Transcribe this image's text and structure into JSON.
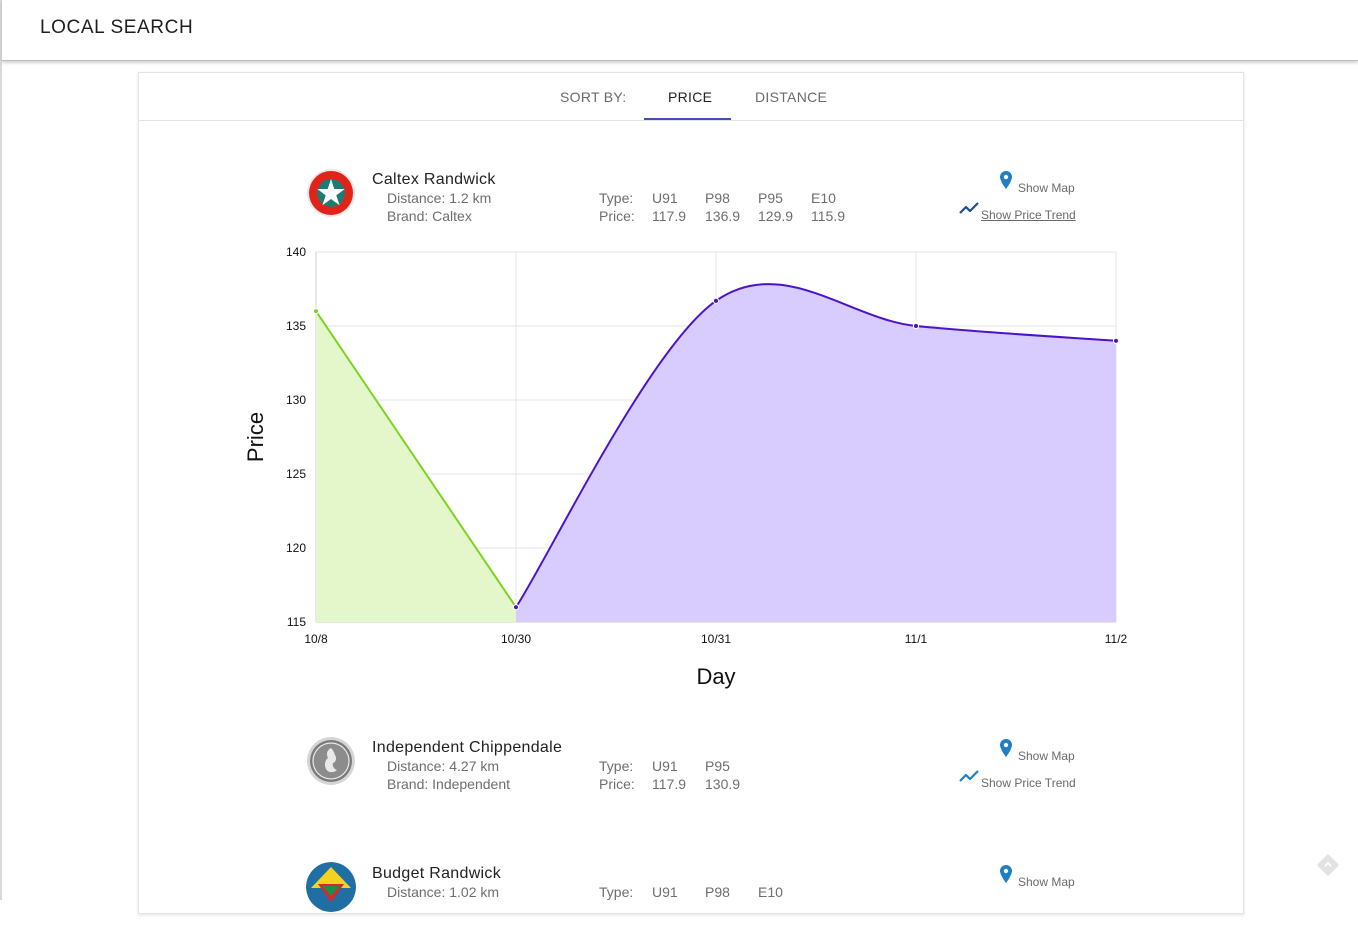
{
  "app": {
    "title": "LOCAL SEARCH"
  },
  "tabs": {
    "sort_label": "SORT BY:",
    "price": "PRICE",
    "distance": "DISTANCE",
    "active": "price"
  },
  "stations": [
    {
      "name": "Caltex Randwick",
      "distance": "Distance: 1.2 km",
      "brand": "Brand: Caltex",
      "type_label": "Type:",
      "price_label": "Price:",
      "fuel_types": [
        "U91",
        "P98",
        "P95",
        "E10"
      ],
      "prices": [
        "117.9",
        "136.9",
        "129.9",
        "115.9"
      ],
      "show_map": "Show Map",
      "show_trend": "Show Price Trend",
      "logo": "caltex-star-logo"
    },
    {
      "name": "Independent Chippendale",
      "distance": "Distance: 4.27 km",
      "brand": "Brand: Independent",
      "type_label": "Type:",
      "price_label": "Price:",
      "fuel_types": [
        "U91",
        "P95"
      ],
      "prices": [
        "117.9",
        "130.9"
      ],
      "show_map": "Show Map",
      "show_trend": "Show Price Trend",
      "logo": "independent-logo"
    },
    {
      "name": "Budget Randwick",
      "distance": "Distance: 1.02 km",
      "brand": "",
      "type_label": "Type:",
      "price_label": "",
      "fuel_types": [
        "U91",
        "P98",
        "E10"
      ],
      "prices": [],
      "show_map": "Show Map",
      "show_trend": "",
      "logo": "budget-logo"
    }
  ],
  "colors": {
    "accent": "#3f51b5",
    "pin": "#1e7fc4",
    "trend_icon": "#1f4f8a",
    "series_1": "#7ed321",
    "series_2": "#4a14c9"
  },
  "chart_data": {
    "type": "area",
    "xlabel": "Day",
    "ylabel": "Price",
    "categories": [
      "10/8",
      "10/30",
      "10/31",
      "11/1",
      "11/2"
    ],
    "ylim": [
      115,
      140
    ],
    "yticks": [
      140,
      135,
      130,
      125,
      120,
      115
    ],
    "grid": true,
    "series": [
      {
        "x": [
          "10/8",
          "10/30"
        ],
        "values": [
          136,
          116
        ],
        "fill": "#e3f7ca",
        "stroke": "#7ed321",
        "curve": "linear"
      },
      {
        "x": [
          "10/30",
          "10/31",
          "11/1",
          "11/2"
        ],
        "values": [
          116,
          136.7,
          135,
          134
        ],
        "fill": "#d8ccff",
        "stroke": "#4a14c9",
        "curve": "smooth"
      }
    ]
  }
}
